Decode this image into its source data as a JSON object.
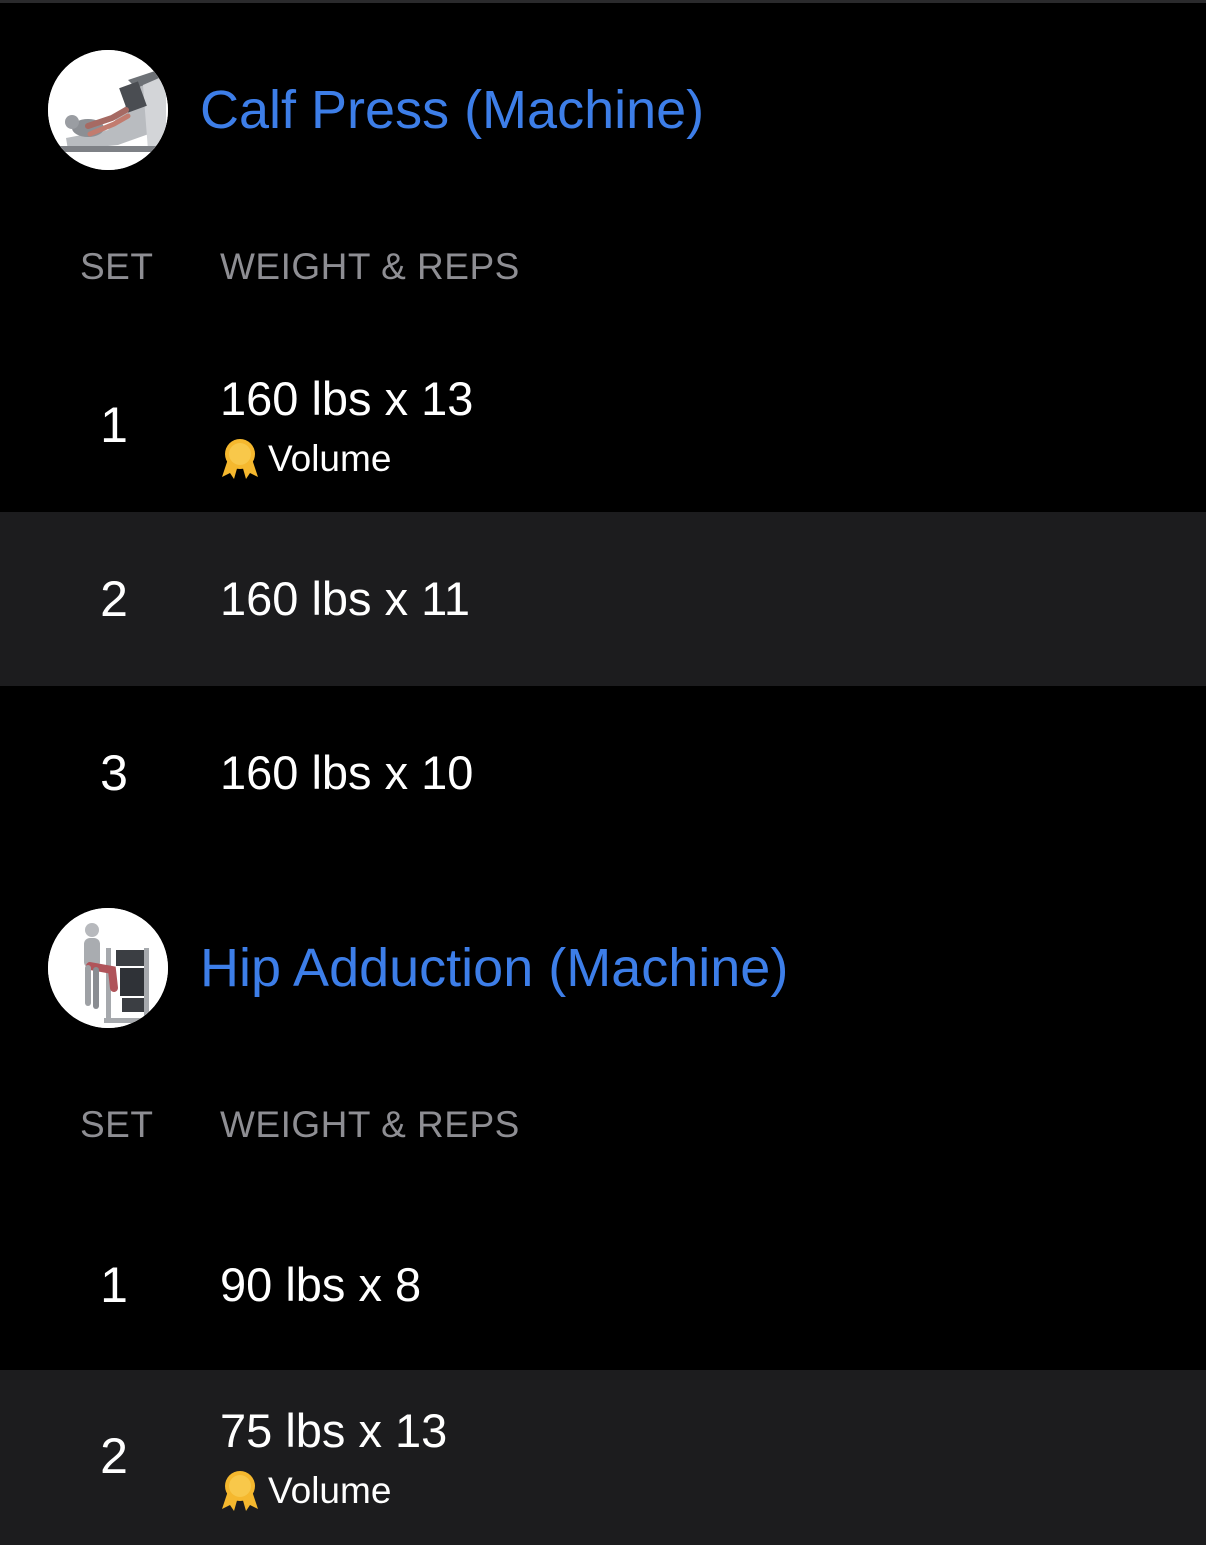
{
  "colors": {
    "background": "#000000",
    "alt_row": "#1c1c1e",
    "title_accent": "#3d7ee8",
    "header_text": "#8e8e93",
    "primary_text": "#ffffff",
    "medal": "#f5b82e"
  },
  "exercises": [
    {
      "title": "Calf Press (Machine)",
      "thumbnail_icon": "calf-press-machine-illustration",
      "columns": {
        "set": "SET",
        "weight_reps": "WEIGHT & REPS"
      },
      "sets": [
        {
          "set": "1",
          "weight_reps": "160 lbs x 13",
          "pr_icon": "medal-icon",
          "pr_label": "Volume"
        },
        {
          "set": "2",
          "weight_reps": "160 lbs x 11"
        },
        {
          "set": "3",
          "weight_reps": "160 lbs x 10"
        }
      ]
    },
    {
      "title": "Hip Adduction (Machine)",
      "thumbnail_icon": "hip-adduction-machine-illustration",
      "columns": {
        "set": "SET",
        "weight_reps": "WEIGHT & REPS"
      },
      "sets": [
        {
          "set": "1",
          "weight_reps": "90 lbs x 8"
        },
        {
          "set": "2",
          "weight_reps": "75 lbs x 13",
          "pr_icon": "medal-icon",
          "pr_label": "Volume"
        }
      ]
    }
  ]
}
